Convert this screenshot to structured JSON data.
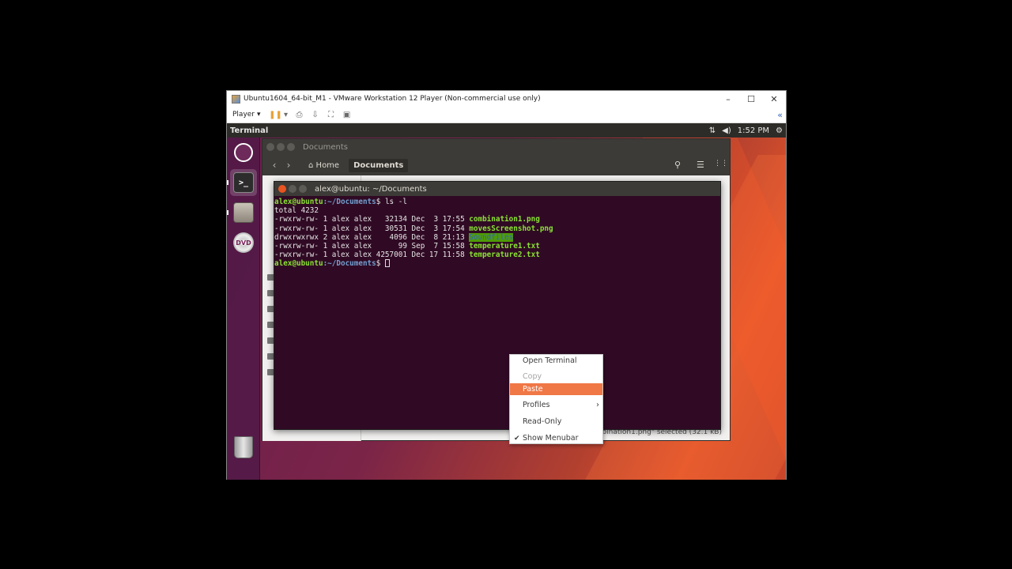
{
  "vm": {
    "title": "Ubuntu1604_64-bit_M1 - VMware Workstation 12 Player (Non-commercial use only)",
    "player_label": "Player",
    "player_arrow": "▾",
    "minimize": "–",
    "maximize": "☐",
    "close": "✕",
    "collapse": "«"
  },
  "top_panel": {
    "app_name": "Terminal",
    "time": "1:52 PM",
    "network_icon": "⇅",
    "volume_icon": "◀)",
    "settings_icon": "⚙"
  },
  "launcher": {
    "items": [
      "dash-icon",
      "terminal-icon",
      "files-icon",
      "dvd-icon",
      "trash-icon"
    ],
    "dvd_label": "DVD"
  },
  "files": {
    "title": "Documents",
    "crumb_home": "Home",
    "crumb_current": "Documents",
    "back": "‹",
    "forward": "›",
    "home_icon": "⌂",
    "search_icon": "⚲",
    "list_icon": "☰",
    "grid_icon": "⋮⋮",
    "status": "\"combination1.png\" selected  (32.1 kB)"
  },
  "terminal": {
    "title": "alex@ubuntu: ~/Documents",
    "prompt_user": "alex@ubuntu",
    "prompt_path": ":~/Documents",
    "prompt_dollar": "$ ",
    "command": "ls -l",
    "total": "total 4232",
    "rows": [
      {
        "meta": "-rwxrw-rw- 1 alex alex   32134 Dec  3 17:55 ",
        "name": "combination1.png",
        "kind": "exec"
      },
      {
        "meta": "-rwxrw-rw- 1 alex alex   30531 Dec  3 17:54 ",
        "name": "movesScreenshot.png",
        "kind": "exec"
      },
      {
        "meta": "drwxrwxrwx 2 alex alex    4096 Dec  8 21:13 ",
        "name": "Soundfiles",
        "kind": "dir"
      },
      {
        "meta": "-rwxrw-rw- 1 alex alex      99 Sep  7 15:58 ",
        "name": "temperature1.txt",
        "kind": "exec"
      },
      {
        "meta": "-rwxrw-rw- 1 alex alex 4257001 Dec 17 11:58 ",
        "name": "temperature2.txt",
        "kind": "exec"
      }
    ]
  },
  "context_menu": {
    "items": [
      {
        "label": "Open Terminal",
        "state": "normal"
      },
      {
        "label": "Copy",
        "state": "disabled"
      },
      {
        "label": "Paste",
        "state": "hover"
      },
      {
        "label": "Profiles",
        "state": "submenu"
      },
      {
        "label": "Read-Only",
        "state": "normal"
      },
      {
        "label": "Show Menubar",
        "state": "checked"
      }
    ],
    "submenu_arrow": "›",
    "check_mark": "✔"
  }
}
